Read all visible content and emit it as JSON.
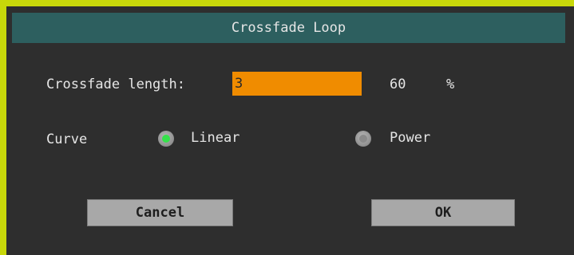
{
  "dialog": {
    "title": "Crossfade Loop",
    "crossfade_length": {
      "label": "Crossfade length:",
      "value": "3",
      "percent_value": "60",
      "percent_unit": "%"
    },
    "curve": {
      "label": "Curve",
      "options": [
        {
          "label": "Linear",
          "selected": true
        },
        {
          "label": "Power",
          "selected": false
        }
      ]
    },
    "buttons": {
      "cancel": "Cancel",
      "ok": "OK"
    }
  },
  "colors": {
    "frame": "#c8d80a",
    "background": "#2e2e2e",
    "title_bar": "#2d5f5f",
    "field": "#f08c00",
    "radio_selected": "#35e24a",
    "button": "#a8a8a8"
  }
}
